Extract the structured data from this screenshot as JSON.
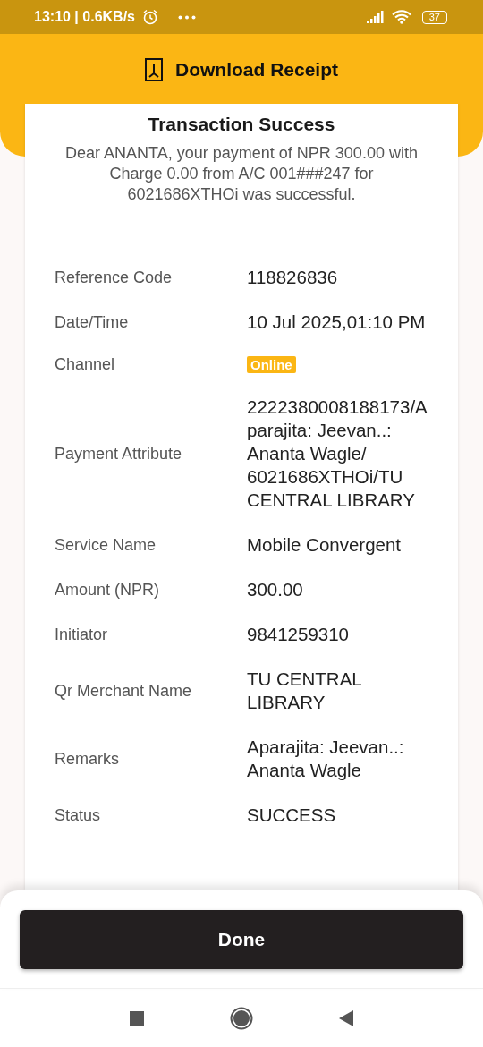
{
  "status_bar": {
    "time": "13:10 | 0.6KB/s",
    "battery": "37"
  },
  "header": {
    "title": "Download Receipt"
  },
  "card": {
    "title": "Transaction Success",
    "message": "Dear ANANTA, your payment of NPR 300.00 with Charge 0.00 from A/C 001###247 for 6021686XTHOi was successful.",
    "details": [
      {
        "label": "Reference Code",
        "value": "118826836",
        "kind": "text"
      },
      {
        "label": "Date/Time",
        "value": "10 Jul 2025,01:10 PM",
        "kind": "text"
      },
      {
        "label": "Channel",
        "value": "Online",
        "kind": "badge"
      },
      {
        "label": "Payment Attribute",
        "value": "2222380008188173/Aparajita: Jeevan..: Ananta Wagle/ 6021686XTHOi/TU CENTRAL LIBRARY",
        "kind": "text"
      },
      {
        "label": "Service Name",
        "value": "Mobile Convergent",
        "kind": "text"
      },
      {
        "label": "Amount (NPR)",
        "value": "300.00",
        "kind": "text"
      },
      {
        "label": "Initiator",
        "value": "9841259310",
        "kind": "text"
      },
      {
        "label": "Qr Merchant Name",
        "value": "TU CENTRAL LIBRARY",
        "kind": "text"
      },
      {
        "label": "Remarks",
        "value": "Aparajita: Jeevan..: Ananta Wagle",
        "kind": "text"
      },
      {
        "label": "Status",
        "value": "SUCCESS",
        "kind": "text"
      }
    ]
  },
  "done_button": "Done"
}
